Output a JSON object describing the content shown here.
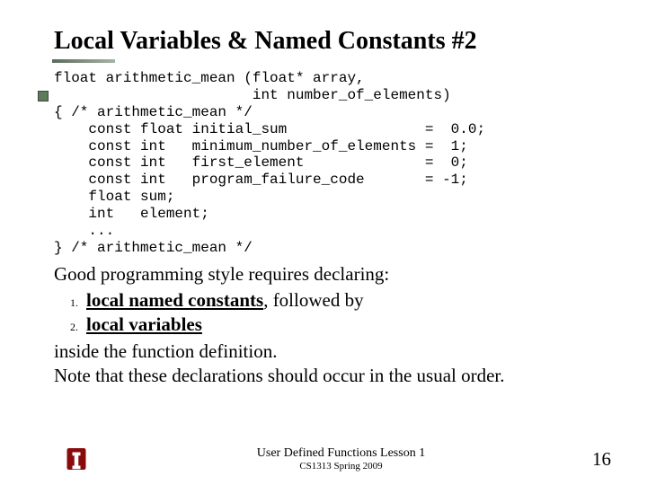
{
  "title": "Local Variables & Named Constants #2",
  "code": "float arithmetic_mean (float* array,\n                       int number_of_elements)\n{ /* arithmetic_mean */\n    const float initial_sum                =  0.0;\n    const int   minimum_number_of_elements =  1;\n    const int   first_element              =  0;\n    const int   program_failure_code       = -1;\n    float sum;\n    int   element;\n    ...\n} /* arithmetic_mean */",
  "body": {
    "intro": "Good programming style requires declaring:",
    "item1_bold_ul": "local named constants",
    "item1_tail": ", followed by",
    "item2_bold_ul": "local variables",
    "outro1": "inside the function definition.",
    "outro2": "Note that these declarations should occur in the usual order."
  },
  "footer": {
    "line1": "User Defined Functions Lesson 1",
    "line2": "CS1313 Spring 2009",
    "page": "16"
  }
}
